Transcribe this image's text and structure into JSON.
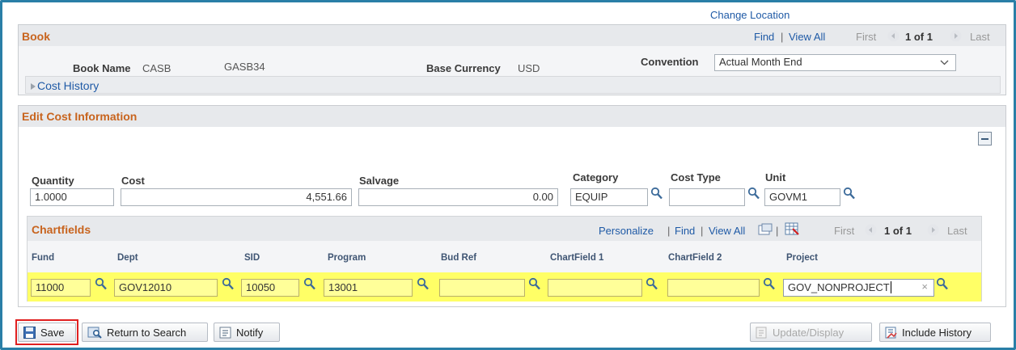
{
  "header": {
    "change_location": "Change Location"
  },
  "book": {
    "title": "Book",
    "nav": {
      "find": "Find",
      "sep": "|",
      "view_all": "View All",
      "first": "First",
      "count": "1 of 1",
      "last": "Last"
    },
    "book_name_label": "Book Name",
    "book_name_value": "CASB",
    "book_desc": "GASB34",
    "base_currency_label": "Base Currency",
    "base_currency_value": "USD",
    "convention_label": "Convention",
    "convention_value": "Actual Month End",
    "cost_history": "Cost History"
  },
  "edit_cost": {
    "title": "Edit Cost Information",
    "quantity": {
      "label": "Quantity",
      "value": "1.0000"
    },
    "cost": {
      "label": "Cost",
      "value": "4,551.66"
    },
    "salvage": {
      "label": "Salvage",
      "value": "0.00"
    },
    "category": {
      "label": "Category",
      "value": "EQUIP"
    },
    "cost_type": {
      "label": "Cost Type",
      "value": ""
    },
    "unit": {
      "label": "Unit",
      "value": "GOVM1"
    }
  },
  "chartfields": {
    "title": "Chartfields",
    "nav": {
      "personalize": "Personalize",
      "find": "Find",
      "view_all": "View All",
      "first": "First",
      "count": "1 of 1",
      "last": "Last"
    },
    "columns": [
      "Fund",
      "Dept",
      "SID",
      "Program",
      "Bud Ref",
      "ChartField 1",
      "ChartField 2",
      "Project"
    ],
    "row": {
      "fund": "11000",
      "dept": "GOV12010",
      "sid": "10050",
      "program": "13001",
      "bud_ref": "",
      "chartfield1": "",
      "chartfield2": "",
      "project": "GOV_NONPROJECT"
    }
  },
  "toolbar": {
    "save": "Save",
    "return_to_search": "Return to Search",
    "notify": "Notify",
    "update_display": "Update/Display",
    "include_history": "Include History"
  }
}
